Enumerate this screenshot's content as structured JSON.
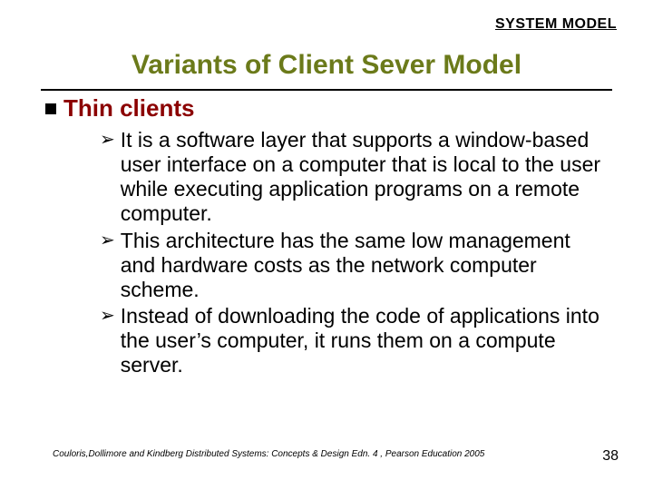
{
  "header": {
    "label": "SYSTEM MODEL"
  },
  "title": "Variants of Client Sever Model",
  "section": {
    "heading": "Thin clients",
    "bullets": [
      "It is a software layer that supports a window-based user interface on a computer that is local to the user while executing application programs on a remote computer.",
      "This architecture has the same low management and hardware costs as the network computer scheme.",
      "Instead of downloading the code of applications into the user’s computer, it runs them on a compute server."
    ]
  },
  "footer": {
    "citation": "Couloris,Dollimore and Kindberg  Distributed Systems: Concepts & Design  Edn. 4 , Pearson Education 2005",
    "page": "38"
  }
}
